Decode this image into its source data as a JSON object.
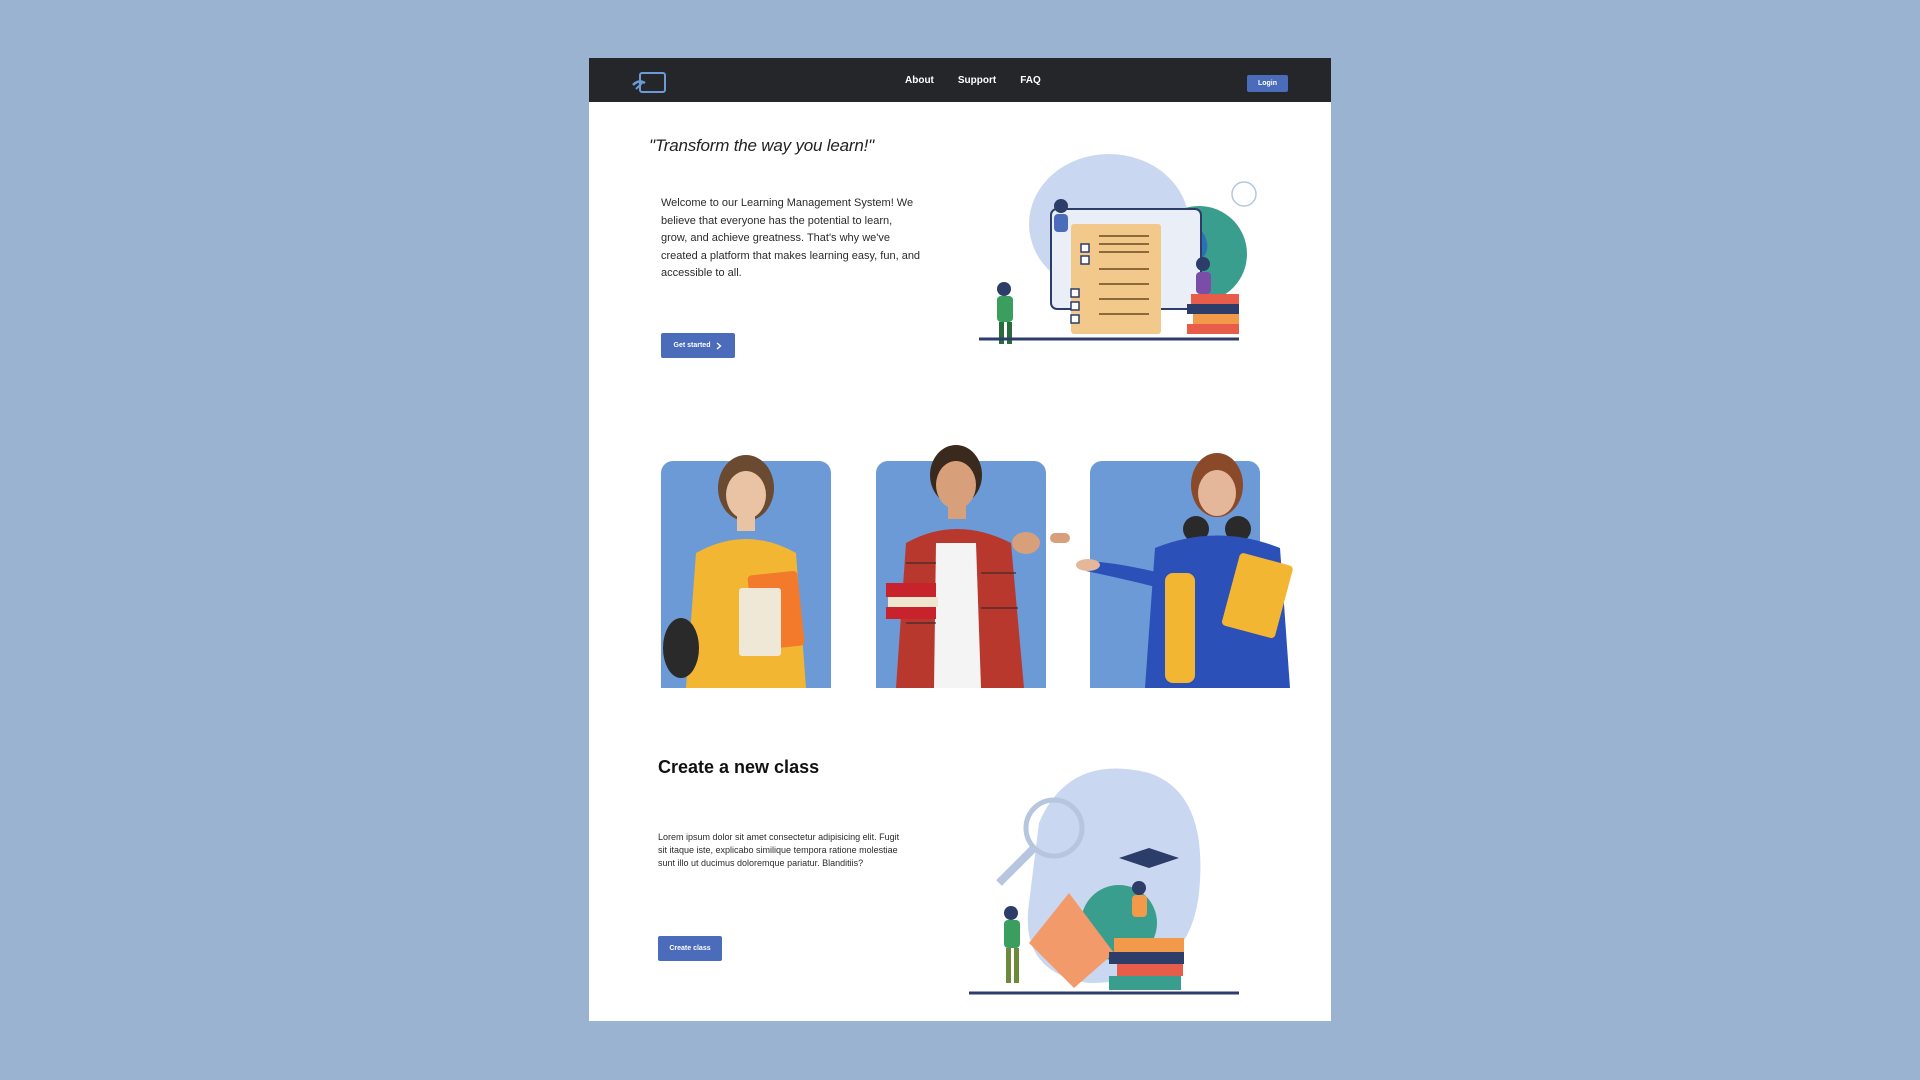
{
  "nav": {
    "links": [
      "About",
      "Support",
      "FAQ"
    ],
    "login_label": "Login"
  },
  "hero": {
    "quote": "\"Transform the way you learn!\"",
    "description": "Welcome to our Learning Management System! We believe that everyone has the potential to learn, grow, and achieve greatness. That's why we've created a platform that makes learning easy, fun, and accessible to all.",
    "cta_label": "Get started",
    "cta_icon": "chevron-right-icon"
  },
  "students": {
    "cards": [
      "student-yellow-shirt",
      "student-plaid-shirt",
      "student-blue-hoodie"
    ]
  },
  "create_section": {
    "title": "Create a new class",
    "description": "Lorem ipsum dolor sit amet consectetur adipisicing elit. Fugit sit itaque iste, explicabo similique tempora ratione molestiae sunt illo ut ducimus doloremque pariatur. Blanditiis?",
    "cta_label": "Create class"
  },
  "colors": {
    "page_bg": "#99b3d1",
    "navbar": "#24262a",
    "accent": "#4a6cba",
    "card_bg": "#6b9ad6"
  }
}
